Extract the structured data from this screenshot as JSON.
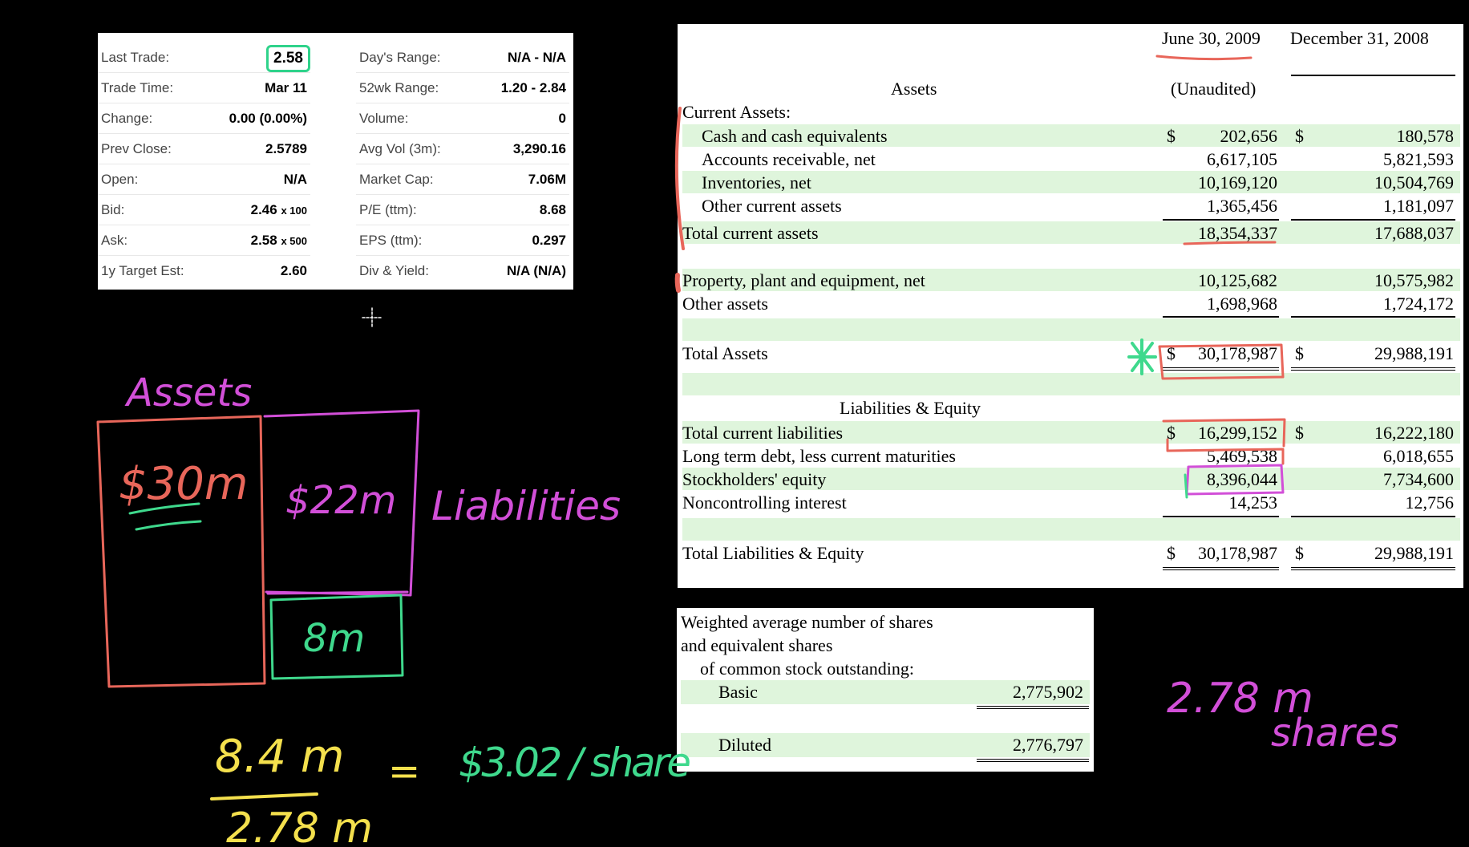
{
  "quote": {
    "left": [
      {
        "label": "Last Trade:",
        "value": "2.58"
      },
      {
        "label": "Trade Time:",
        "value": "Mar 11"
      },
      {
        "label": "Change:",
        "value": "0.00 (0.00%)"
      },
      {
        "label": "Prev Close:",
        "value": "2.5789"
      },
      {
        "label": "Open:",
        "value": "N/A"
      },
      {
        "label": "Bid:",
        "value": "2.46",
        "extra": "x 100"
      },
      {
        "label": "Ask:",
        "value": "2.58",
        "extra": "x 500"
      },
      {
        "label": "1y Target Est:",
        "value": "2.60"
      }
    ],
    "right": [
      {
        "label": "Day's Range:",
        "value": "N/A - N/A"
      },
      {
        "label": "52wk Range:",
        "value": "1.20 - 2.84"
      },
      {
        "label": "Volume:",
        "value": "0"
      },
      {
        "label": "Avg Vol (3m):",
        "value": "3,290.16"
      },
      {
        "label": "Market Cap:",
        "value": "7.06M"
      },
      {
        "label": "P/E (ttm):",
        "value": "8.68"
      },
      {
        "label": "EPS (ttm):",
        "value": "0.297"
      },
      {
        "label": "Div & Yield:",
        "value": "N/A (N/A)"
      }
    ]
  },
  "balance_sheet": {
    "col1_header": "June 30, 2009",
    "col2_header": "December 31, 2008",
    "unaudited": "(Unaudited)",
    "assets_header": "Assets",
    "current_assets_label": "Current Assets:",
    "liab_header": "Liabilities & Equity",
    "currency": "$",
    "rows": {
      "cash": {
        "label": "Cash and cash equivalents",
        "v1": "202,656",
        "v2": "180,578"
      },
      "ar": {
        "label": "Accounts receivable, net",
        "v1": "6,617,105",
        "v2": "5,821,593"
      },
      "inv": {
        "label": "Inventories, net",
        "v1": "10,169,120",
        "v2": "10,504,769"
      },
      "oca": {
        "label": "Other current assets",
        "v1": "1,365,456",
        "v2": "1,181,097"
      },
      "tca": {
        "label": "Total current assets",
        "v1": "18,354,337",
        "v2": "17,688,037"
      },
      "ppe": {
        "label": "Property, plant and equipment, net",
        "v1": "10,125,682",
        "v2": "10,575,982"
      },
      "oa": {
        "label": "Other assets",
        "v1": "1,698,968",
        "v2": "1,724,172"
      },
      "ta": {
        "label": "Total Assets",
        "v1": "30,178,987",
        "v2": "29,988,191"
      },
      "tcl": {
        "label": "Total current liabilities",
        "v1": "16,299,152",
        "v2": "16,222,180"
      },
      "ltd": {
        "label": "Long term debt, less current maturities",
        "v1": "5,469,538",
        "v2": "6,018,655"
      },
      "se": {
        "label": "Stockholders' equity",
        "v1": "8,396,044",
        "v2": "7,734,600"
      },
      "nci": {
        "label": "Noncontrolling interest",
        "v1": "14,253",
        "v2": "12,756"
      },
      "tle": {
        "label": "Total Liabilities & Equity",
        "v1": "30,178,987",
        "v2": "29,988,191"
      }
    }
  },
  "shares": {
    "line1": "Weighted average number of shares",
    "line2": "and equivalent shares",
    "line3": "of common stock outstanding:",
    "basic_label": "Basic",
    "basic_value": "2,775,902",
    "diluted_label": "Diluted",
    "diluted_value": "2,776,797"
  },
  "annotations": {
    "assets": "Assets",
    "assets_value": "$30m",
    "liab_value": "$22m",
    "liab_label": "Liabilities",
    "equity_value": "8m",
    "numerator": "8.4 m",
    "denominator": "2.78 m",
    "equals": "=",
    "result": "$3.02 / share",
    "shares_note1": "2.78 m",
    "shares_note2": "shares"
  },
  "colors": {
    "red": "#e8665a",
    "pink": "#d24fd8",
    "green": "#3fd98d",
    "yellow": "#f4e04d",
    "sheet_green": "#dff5dc"
  }
}
